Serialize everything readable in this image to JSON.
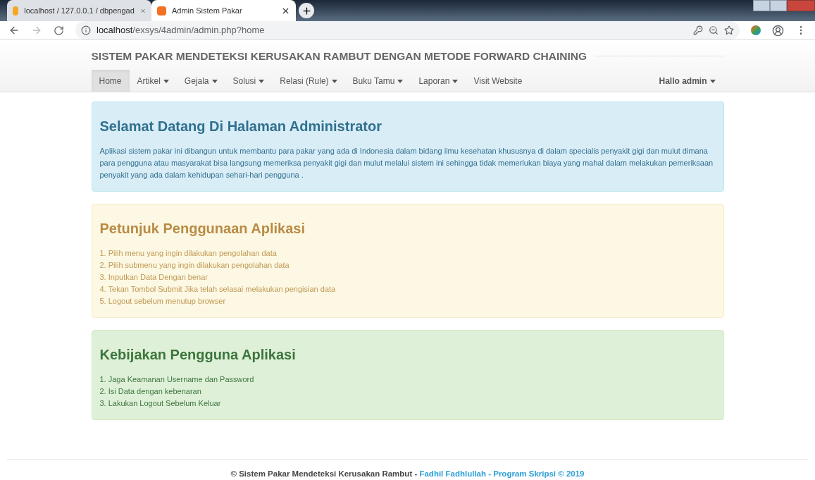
{
  "browser_tabs": [
    {
      "title": "localhost / 127.0.0.1 / dbpengad",
      "selected": false
    },
    {
      "title": "Admin Sistem Pakar",
      "selected": true
    }
  ],
  "address_bar": {
    "host": "localhost",
    "path": "/exsys/4admin/admin.php?home"
  },
  "site_title": "SISTEM PAKAR MENDETEKSI KERUSAKAN RAMBUT DENGAN METODE FORWARD CHAINING",
  "nav": {
    "items": [
      {
        "label": "Home",
        "dropdown": false,
        "selected": true
      },
      {
        "label": "Artikel",
        "dropdown": true,
        "selected": false
      },
      {
        "label": "Gejala",
        "dropdown": true,
        "selected": false
      },
      {
        "label": "Solusi",
        "dropdown": true,
        "selected": false
      },
      {
        "label": "Relasi (Rule)",
        "dropdown": true,
        "selected": false
      },
      {
        "label": "Buku Tamu",
        "dropdown": true,
        "selected": false
      },
      {
        "label": "Laporan",
        "dropdown": true,
        "selected": false
      },
      {
        "label": "Visit Website",
        "dropdown": false,
        "selected": false
      }
    ],
    "user": {
      "label": "Hallo admin",
      "dropdown": true
    }
  },
  "panels": [
    {
      "kind": "info",
      "title": "Selamat Datang Di Halaman Administrator",
      "lines": [
        "Aplikasi sistem pakar ini dibangun untuk membantu para pakar yang ada di Indonesia dalam bidang ilmu kesehatan khususnya di dalam specialis penyakit gigi dan mulut dimana para pengguna atau masyarakat bisa langsung memeriksa penyakit gigi dan mulut melalui sistem ini sehingga tidak memerlukan biaya yang mahal dalam melakukan pemeriksaan penyakit yang ada dalam kehidupan sehari-hari pengguna ."
      ]
    },
    {
      "kind": "warning",
      "title": "Petunjuk Penggunaan Aplikasi",
      "lines": [
        "1. Pilih menu yang ingin dilakukan pengolahan data",
        "2. Pilih submenu yang ingin dilakukan pengolahan data",
        "3. Inputkan Data Dengan benar",
        "4. Tekan Tombol Submit Jika telah selasai melakukan pengisian data",
        "5. Logout sebelum menutup browser"
      ]
    },
    {
      "kind": "success",
      "title": "Kebijakan Pengguna Aplikasi",
      "lines": [
        "1. Jaga Keamanan Username dan Password",
        "2. Isi Data dengan kebenaran",
        "3. Lakukan Logout Sebelum Keluar"
      ]
    }
  ],
  "footer": {
    "text": "© Sistem Pakar Mendeteksi Kerusakan Rambut - ",
    "link": "Fadhil Fadhlullah - Program Skripsi © 2019"
  }
}
